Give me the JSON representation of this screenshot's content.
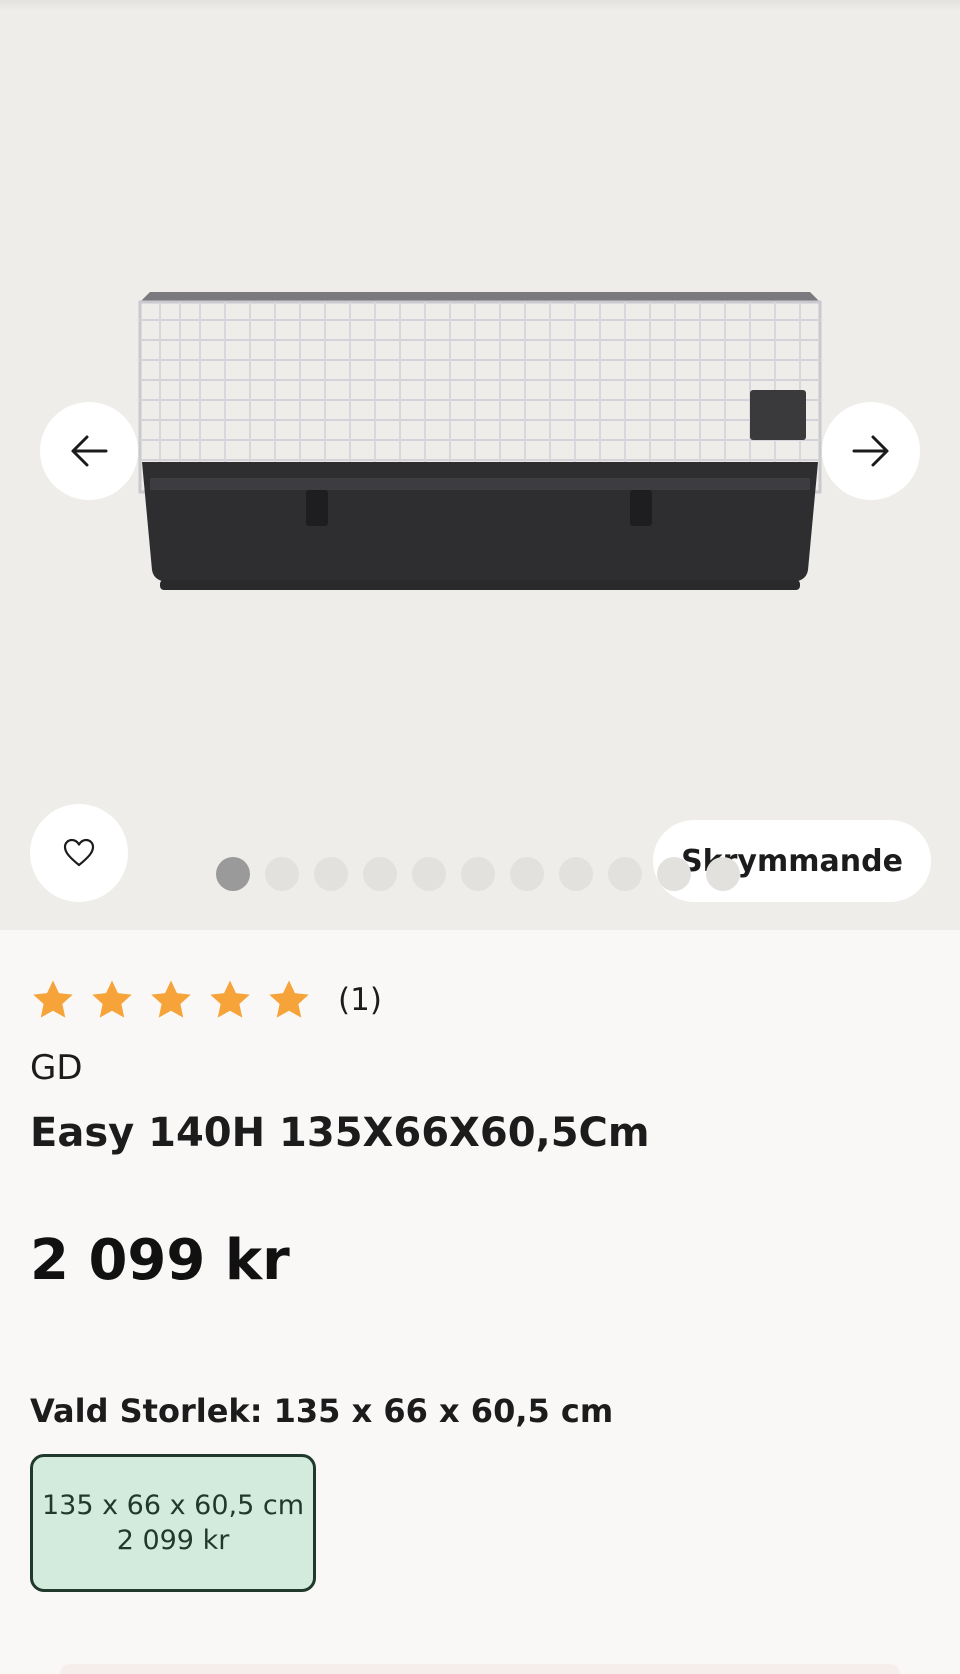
{
  "gallery": {
    "image_count": 11,
    "active_index": 0,
    "bulky_badge": "Skrymmande"
  },
  "product": {
    "rating": 5,
    "review_count": "(1)",
    "brand": "GD",
    "title": "Easy 140H 135X66X60,5Cm",
    "price": "2 099 kr"
  },
  "size": {
    "label": "Vald Storlek: 135 x 66 x 60,5 cm",
    "options": [
      {
        "dimensions": "135 x 66 x 60,5 cm",
        "price": "2 099 kr"
      }
    ]
  },
  "colors": {
    "gallery_bg": "#eeedea",
    "star": "#f6a43a",
    "selected_option_bg": "#d3ebdc",
    "selected_option_border": "#1f3a2c"
  },
  "icons": [
    "arrow-left-icon",
    "arrow-right-icon",
    "heart-icon",
    "star-icon"
  ]
}
